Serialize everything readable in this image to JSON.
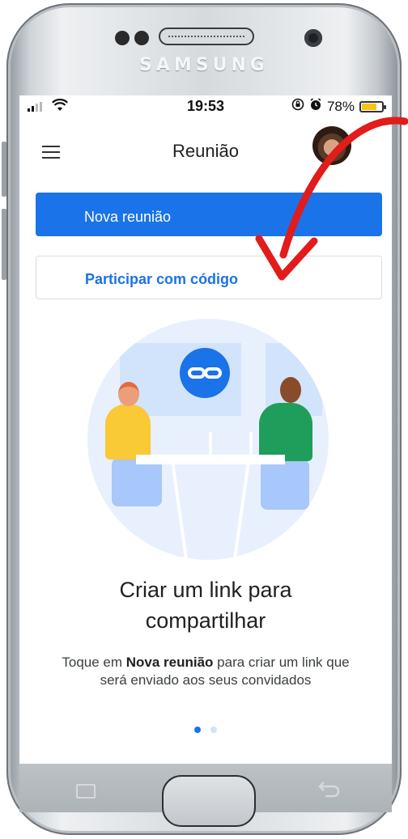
{
  "device": {
    "brand": "SAMSUNG"
  },
  "status_bar": {
    "time": "19:53",
    "battery": "78%",
    "battery_level": 0.78
  },
  "app_bar": {
    "title": "Reunião"
  },
  "buttons": {
    "new_meeting": "Nova reunião",
    "join_with_code": "Participar com código"
  },
  "onboarding": {
    "heading_line1": "Criar um link para",
    "heading_line2": "compartilhar",
    "body_prefix": "Toque em ",
    "body_bold": "Nova reunião",
    "body_suffix": " para criar um link que será enviado aos seus convidados",
    "page_count": 2,
    "active_page": 1
  },
  "colors": {
    "primary": "#1a73e8",
    "annotation_arrow": "#e21b1b"
  },
  "icons": {
    "menu": "hamburger-menu-icon",
    "link": "link-icon",
    "wifi": "wifi-icon",
    "alarm": "alarm-icon",
    "rotation_lock": "rotation-lock-icon"
  }
}
